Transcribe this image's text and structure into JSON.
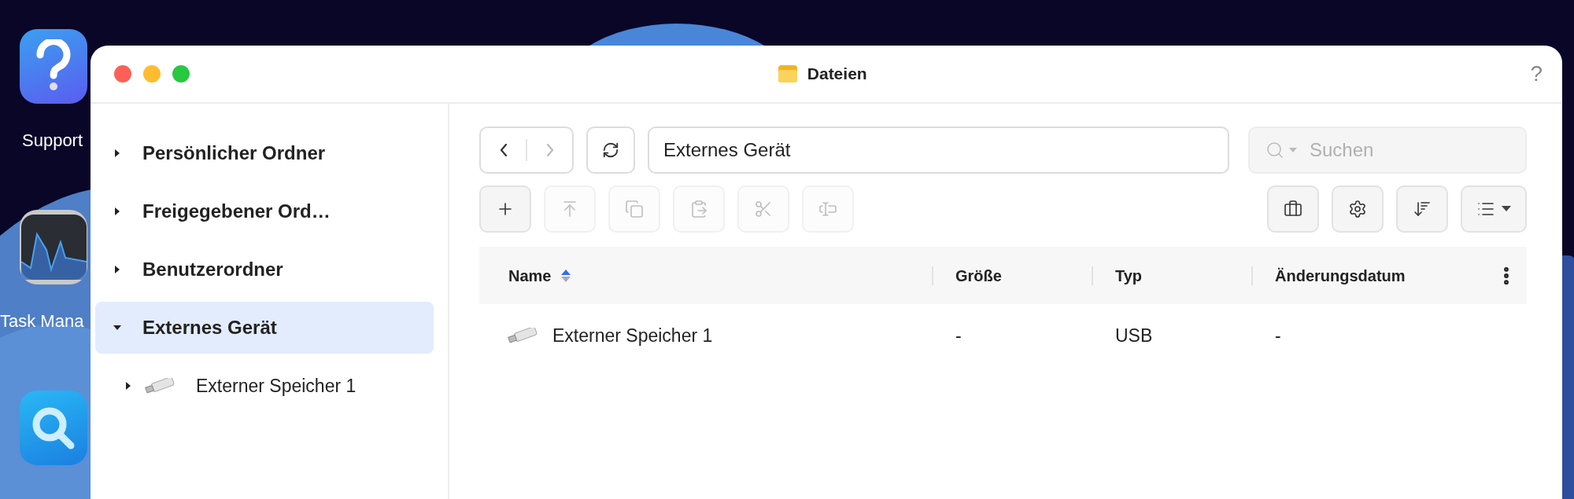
{
  "desktop_icons": [
    {
      "kind": "help",
      "label": "Support"
    },
    {
      "kind": "monitor",
      "label": "Task Mana"
    },
    {
      "kind": "search"
    }
  ],
  "window": {
    "title": "Dateien",
    "help": "?"
  },
  "sidebar": {
    "items": [
      {
        "label": "Persönlicher Ordner",
        "expanded": false,
        "selected": false
      },
      {
        "label": "Freigegebener Ord…",
        "expanded": false,
        "selected": false
      },
      {
        "label": "Benutzerordner",
        "expanded": false,
        "selected": false
      },
      {
        "label": "Externes Gerät",
        "expanded": true,
        "selected": true,
        "children": [
          {
            "label": "Externer Speicher 1",
            "expanded": false,
            "selected": false
          }
        ]
      }
    ]
  },
  "navigation": {
    "back_disabled": false,
    "forward_disabled": true
  },
  "path": {
    "value": "Externes Gerät"
  },
  "search": {
    "placeholder": "Suchen"
  },
  "toolbar_left": [
    {
      "kind": "add",
      "disabled": false
    },
    {
      "kind": "upload",
      "disabled": true
    },
    {
      "kind": "copy",
      "disabled": true
    },
    {
      "kind": "paste",
      "disabled": true
    },
    {
      "kind": "cut",
      "disabled": true
    },
    {
      "kind": "rename",
      "disabled": true
    }
  ],
  "toolbar_right": [
    {
      "kind": "tools"
    },
    {
      "kind": "settings"
    },
    {
      "kind": "sort"
    },
    {
      "kind": "view"
    }
  ],
  "table": {
    "columns": [
      {
        "label": "Name",
        "sorted_ascending": true
      },
      {
        "label": "Größe"
      },
      {
        "label": "Typ"
      },
      {
        "label": "Änderungsdatum"
      }
    ],
    "rows": [
      {
        "name": "Externer Speicher 1",
        "size": "-",
        "type": "USB",
        "modified": "-"
      }
    ]
  }
}
